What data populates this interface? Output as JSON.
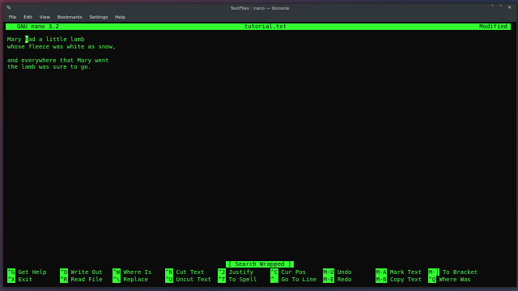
{
  "window": {
    "title": "TextFiles : nano — Konsole",
    "menu": [
      "File",
      "Edit",
      "View",
      "Bookmarks",
      "Settings",
      "Help"
    ]
  },
  "nano": {
    "version": "GNU nano 3.2",
    "filename": "tutorial.txt",
    "state": "Modified"
  },
  "editor": {
    "lines": [
      {
        "before": "Mary ",
        "cursor": "h",
        "after": "ad a little lamb"
      },
      {
        "before": "whose fleece was white as snow,",
        "cursor": "",
        "after": ""
      },
      {
        "before": "",
        "cursor": "",
        "after": ""
      },
      {
        "before": "and everywhere that Mary went",
        "cursor": "",
        "after": ""
      },
      {
        "before": "the lamb was sure to go.",
        "cursor": "",
        "after": ""
      }
    ]
  },
  "status_message": "[ Search Wrapped ]",
  "shortcuts": {
    "row1": [
      {
        "key": "^G",
        "label": "Get Help"
      },
      {
        "key": "^O",
        "label": "Write Out"
      },
      {
        "key": "^W",
        "label": "Where Is"
      },
      {
        "key": "^K",
        "label": "Cut Text"
      },
      {
        "key": "^J",
        "label": "Justify"
      },
      {
        "key": "^C",
        "label": "Cur Pos"
      },
      {
        "key": "M-U",
        "label": "Undo"
      },
      {
        "key": "M-A",
        "label": "Mark Text"
      },
      {
        "key": "M-]",
        "label": "To Bracket"
      }
    ],
    "row2": [
      {
        "key": "^X",
        "label": "Exit"
      },
      {
        "key": "^R",
        "label": "Read File"
      },
      {
        "key": "^\\",
        "label": "Replace"
      },
      {
        "key": "^U",
        "label": "Uncut Text"
      },
      {
        "key": "^T",
        "label": "To Spell"
      },
      {
        "key": "^_",
        "label": "Go To Line"
      },
      {
        "key": "M-E",
        "label": "Redo"
      },
      {
        "key": "M-6",
        "label": "Copy Text"
      },
      {
        "key": "^Q",
        "label": "Where Was"
      }
    ]
  },
  "colors": {
    "terminal_bg": "#0b0b0b",
    "nano_green": "#33ff33",
    "text_green": "#55ff55"
  }
}
